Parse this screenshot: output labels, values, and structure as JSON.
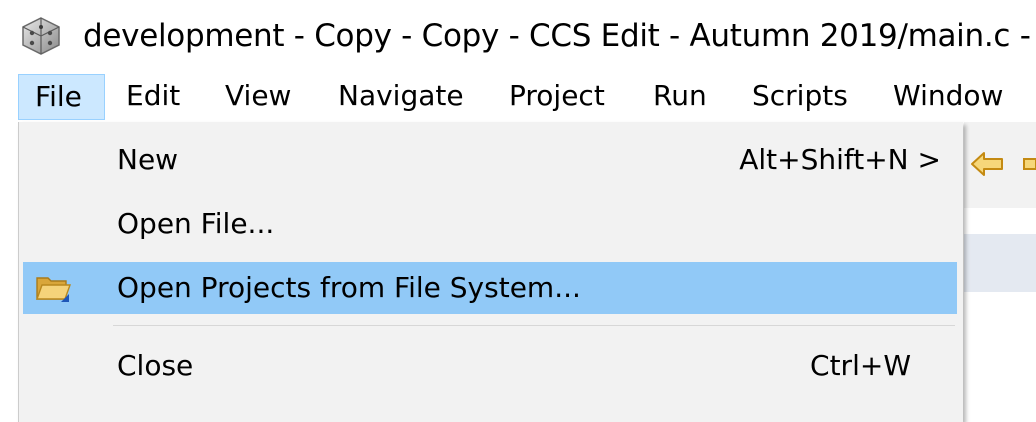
{
  "window": {
    "title": "development - Copy - Copy - CCS Edit - Autumn 2019/main.c -",
    "app_icon": "ccs-app-icon"
  },
  "menubar": {
    "items": [
      {
        "label": "File",
        "active": true
      },
      {
        "label": "Edit"
      },
      {
        "label": "View"
      },
      {
        "label": "Navigate"
      },
      {
        "label": "Project"
      },
      {
        "label": "Run"
      },
      {
        "label": "Scripts"
      },
      {
        "label": "Window"
      }
    ]
  },
  "file_menu": {
    "items": [
      {
        "label": "New",
        "shortcut": "Alt+Shift+N >",
        "icon": ""
      },
      {
        "label": "Open File...",
        "shortcut": "",
        "icon": ""
      },
      {
        "label": "Open Projects from File System...",
        "shortcut": "",
        "icon": "folder-icon",
        "highlighted": true
      },
      {
        "label": "Close",
        "shortcut": "Ctrl+W",
        "icon": ""
      }
    ]
  },
  "toolbar": {
    "icons": [
      "back-arrow-icon",
      "forward-arrow-icon"
    ]
  },
  "colors": {
    "menu_active_bg": "#cce8ff",
    "menu_active_border": "#99d1ff",
    "dropdown_bg": "#f2f2f2",
    "dropdown_highlight": "#91c9f7",
    "separator": "#d7d7d7",
    "view_header": "#e4e9f1"
  }
}
